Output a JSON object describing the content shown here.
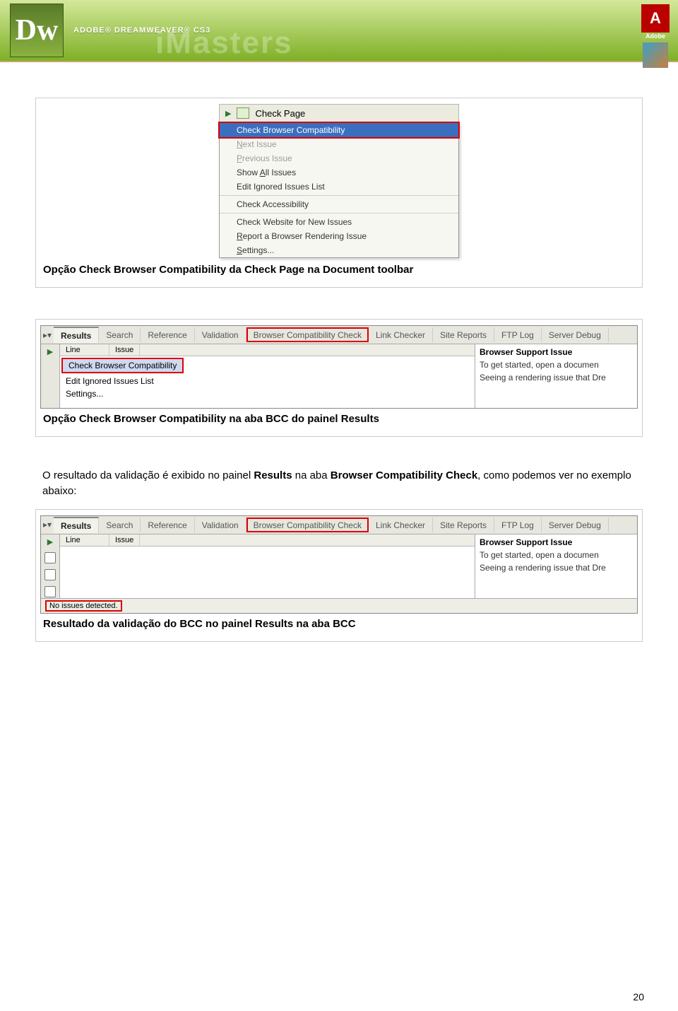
{
  "header": {
    "dw_mark": "Dw",
    "brand_line": "ADOBE® DREAMWEAVER® CS3",
    "watermark": "iMasters",
    "adobe_text": "Adobe"
  },
  "menu": {
    "button": "Check Page",
    "items": [
      {
        "label": "Check Browser Compatibility",
        "selected": true
      },
      {
        "label": "Next Issue",
        "disabled": true
      },
      {
        "label": "Previous Issue",
        "disabled": true
      },
      {
        "label": "Show All Issues"
      },
      {
        "label": "Edit Ignored Issues List"
      }
    ],
    "group2": [
      {
        "label": "Check Accessibility"
      }
    ],
    "group3": [
      {
        "label": "Check Website for New Issues"
      },
      {
        "label": "Report a Browser Rendering Issue"
      },
      {
        "label": "Settings..."
      }
    ]
  },
  "caption1": "Opção Check Browser Compatibility da Check Page na Document toolbar",
  "panel1": {
    "title": "Results",
    "tabs": [
      "Search",
      "Reference",
      "Validation",
      "Browser Compatibility Check",
      "Link Checker",
      "Site Reports",
      "FTP Log",
      "Server Debug"
    ],
    "col1": "Line",
    "col2": "Issue",
    "rows": [
      "Check Browser Compatibility",
      "Edit Ignored Issues List",
      "Settings..."
    ],
    "right_title": "Browser Support Issue",
    "right_l1": "To get started, open a documen",
    "right_l2": "Seeing a rendering issue that Dre"
  },
  "caption2": "Opção Check Browser Compatibility na aba BCC do painel Results",
  "bodytext": "O resultado da validação é exibido no painel Results na aba Browser Compatibility Check, como podemos ver no exemplo abaixo:",
  "panel2": {
    "status": "No issues detected."
  },
  "caption3": "Resultado da validação do BCC no painel Results na aba BCC",
  "page_number": "20"
}
